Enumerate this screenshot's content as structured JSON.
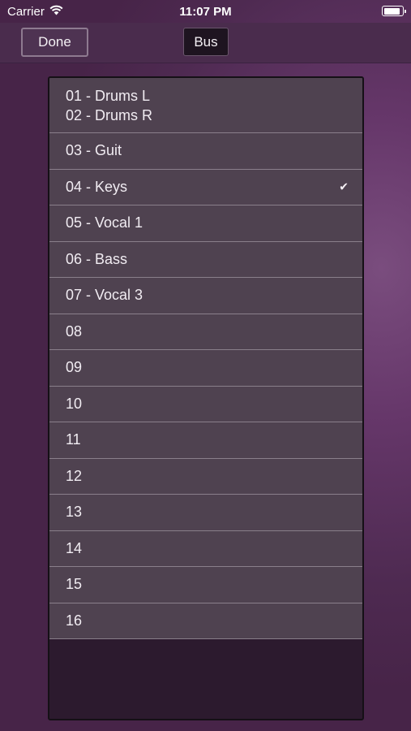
{
  "status_bar": {
    "carrier": "Carrier",
    "time": "11:07 PM",
    "battery_level": 0.9
  },
  "nav": {
    "done_label": "Done",
    "bus_label": "Bus"
  },
  "list": {
    "first_item_lines": [
      "01 - Drums L",
      "02 - Drums R"
    ],
    "items": [
      "03 - Guit",
      "04 - Keys",
      "05 - Vocal 1",
      "06 - Bass",
      "07 - Vocal 3",
      "08",
      "09",
      "10",
      "11",
      "12",
      "13",
      "14",
      "15",
      "16"
    ],
    "selected": "04 - Keys",
    "check_mark": "✔"
  },
  "colors": {
    "background": "#5e3361",
    "row_background": "#4f4250",
    "row_separator": "#8a7f8b"
  }
}
